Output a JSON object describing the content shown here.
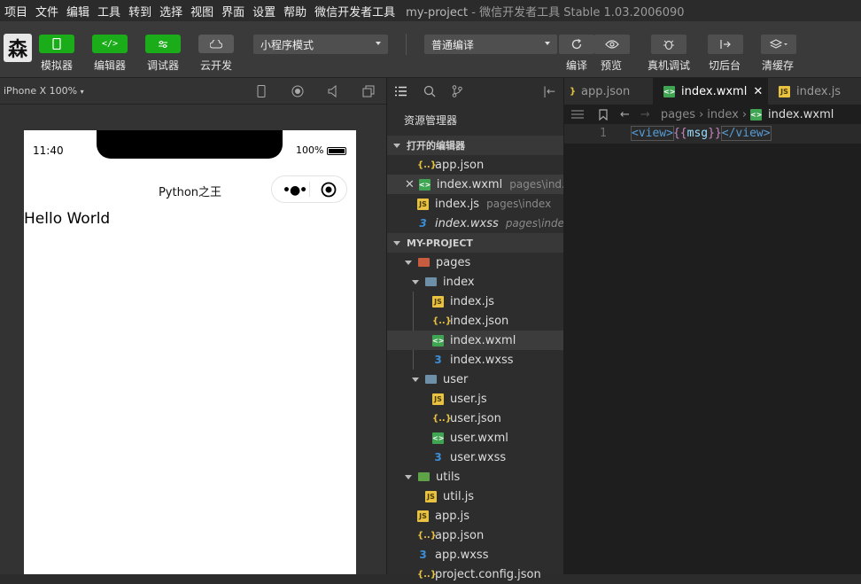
{
  "menubar": {
    "items": [
      "项目",
      "文件",
      "编辑",
      "工具",
      "转到",
      "选择",
      "视图",
      "界面",
      "设置",
      "帮助",
      "微信开发者工具"
    ],
    "title": "my-project",
    "subtitle": "- 微信开发者工具 Stable 1.03.2006090"
  },
  "toolbar": {
    "logo_char": "森",
    "simulator_label": "模拟器",
    "editor_label": "编辑器",
    "debugger_label": "调试器",
    "cloud_label": "云开发",
    "mode_select": "小程序模式",
    "compile_select": "普通编译",
    "compile_label": "编译",
    "preview_label": "预览",
    "realdebug_label": "真机调试",
    "background_label": "切后台",
    "clearcache_label": "清缓存"
  },
  "simulator": {
    "device": "iPhone X 100%",
    "time": "11:40",
    "battery": "100%",
    "nav_title": "Python之王",
    "content": "Hello World"
  },
  "explorer": {
    "title": "资源管理器",
    "open_editors_header": "打开的编辑器",
    "open_editors": [
      {
        "name": "app.json",
        "path": ""
      },
      {
        "name": "index.wxml",
        "path": "pages\\ind..."
      },
      {
        "name": "index.js",
        "path": "pages\\index"
      },
      {
        "name": "index.wxss",
        "path": "pages\\index"
      }
    ],
    "project_header": "MY-PROJECT",
    "tree": [
      "pages",
      "index",
      "index.js",
      "index.json",
      "index.wxml",
      "index.wxss",
      "user",
      "user.js",
      "user.json",
      "user.wxml",
      "user.wxss",
      "utils",
      "util.js",
      "app.js",
      "app.json",
      "app.wxss",
      "project.config.json"
    ]
  },
  "editor": {
    "tabs": [
      "app.json",
      "index.wxml",
      "index.js"
    ],
    "breadcrumb": [
      "pages",
      "index",
      "index.wxml"
    ],
    "line_number": "1",
    "code": {
      "open_tag": "<view>",
      "open_brace": "{{",
      "var": "msg",
      "close_brace": "}}",
      "close_tag": "</view>"
    }
  },
  "colors": {
    "accent_green": "#1aad19",
    "tag_blue": "#569cd6",
    "brace_purple": "#c586c0",
    "var_blue": "#9cdcfe"
  }
}
